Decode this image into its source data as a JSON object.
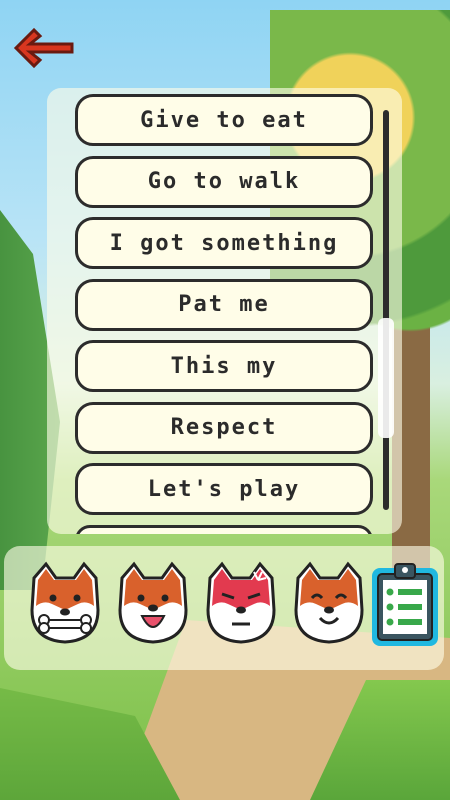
{
  "back_button": {
    "icon": "arrow-left-icon",
    "color": "#d8361f"
  },
  "menu": {
    "items": [
      {
        "label": "Give to eat"
      },
      {
        "label": "Go to walk"
      },
      {
        "label": "I got something"
      },
      {
        "label": "Pat me"
      },
      {
        "label": "This my"
      },
      {
        "label": "Respect"
      },
      {
        "label": "Let's play"
      }
    ],
    "scroll_position": 0.5
  },
  "emote_bar": {
    "emotes": [
      {
        "name": "dog-with-bone-icon"
      },
      {
        "name": "dog-happy-icon"
      },
      {
        "name": "dog-angry-icon"
      },
      {
        "name": "dog-smile-icon"
      }
    ],
    "clipboard": {
      "icon": "clipboard-list-icon",
      "accent": "#20b8e0"
    }
  },
  "colors": {
    "button_fill": "#fffde8",
    "button_border": "#2c2c2c",
    "dog_orange": "#d9612c"
  }
}
